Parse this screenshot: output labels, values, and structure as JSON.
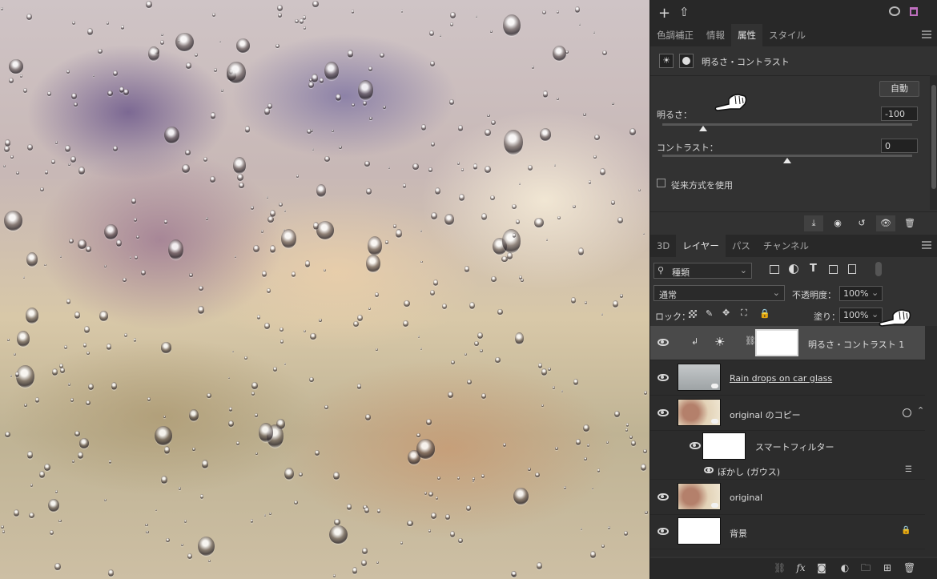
{
  "canvas": {
    "image": "raindrops-on-glass"
  },
  "topbar": {
    "add_label": "+",
    "export_label": "⇧"
  },
  "adjust_tabs": [
    "色調補正",
    "情報",
    "属性",
    "スタイル"
  ],
  "properties": {
    "title": "明るさ・コントラスト",
    "auto_label": "自動",
    "brightness_label": "明るさ：",
    "brightness_value": "-100",
    "contrast_label": "コントラスト：",
    "contrast_value": "0",
    "legacy_label": "従来方式を使用"
  },
  "layer_tabs": [
    "3D",
    "レイヤー",
    "パス",
    "チャンネル"
  ],
  "layer_controls": {
    "filter_kind": "種類",
    "blend_mode": "通常",
    "opacity_label": "不透明度：",
    "opacity_value": "100%",
    "lock_label": "ロック：",
    "fill_label": "塗り：",
    "fill_value": "100%"
  },
  "layers": [
    {
      "name": "明るさ・コントラスト 1"
    },
    {
      "name": "Rain drops on car glass"
    },
    {
      "name": "original のコピー"
    },
    {
      "name": "スマートフィルター"
    },
    {
      "name": "ぼかし (ガウス)"
    },
    {
      "name": "original"
    },
    {
      "name": "背景"
    }
  ],
  "colors": {
    "panel": "#323232",
    "selected_layer": "#4a4a4a"
  }
}
